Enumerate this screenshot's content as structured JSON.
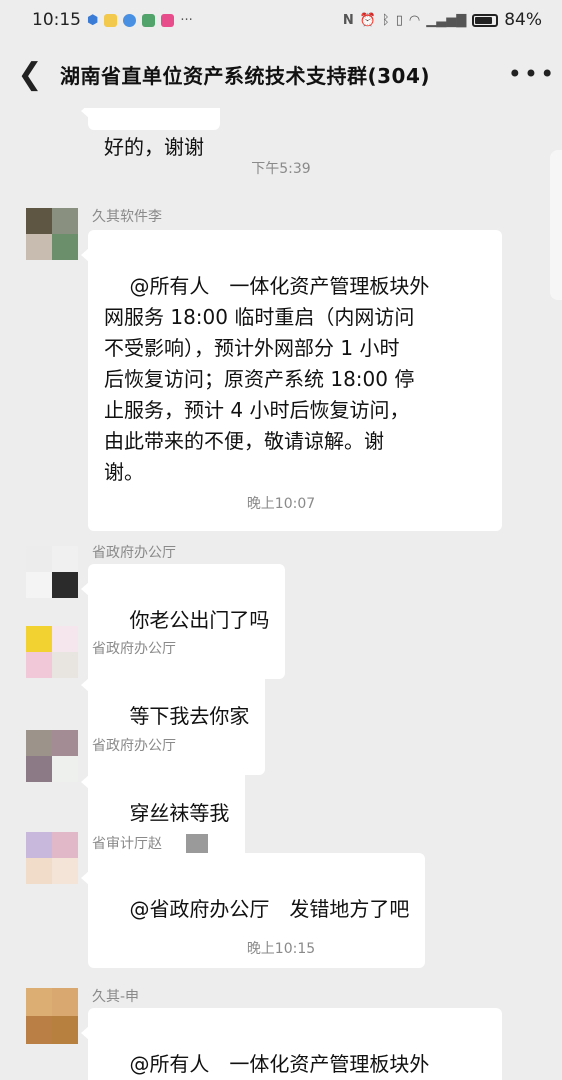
{
  "status": {
    "time": "10:15",
    "battery_text": "84%",
    "battery_level": 0.84
  },
  "header": {
    "title": "湖南省直单位资产系统技术支持群(304)",
    "back_icon": "chevron-left-icon",
    "more_icon": "more-icon"
  },
  "messages": [
    {
      "type": "bubble-partial",
      "text": "好的，谢谢"
    },
    {
      "type": "time",
      "text": "下午5:39"
    },
    {
      "type": "message",
      "sender": "久其软件李",
      "text": "@所有人　一体化资产管理板块外\n网服务 18:00 临时重启（内网访问\n不受影响），预计外网部分 1 小时\n后恢复访问；原资产系统 18:00 停\n止服务，预计 4 小时后恢复访问，\n由此带来的不便，敬请谅解。谢\n谢。"
    },
    {
      "type": "time",
      "text": "晚上10:07"
    },
    {
      "type": "message",
      "sender": "省政府办公厅",
      "text": "你老公出门了吗"
    },
    {
      "type": "message",
      "sender": "省政府办公厅",
      "text": "等下我去你家"
    },
    {
      "type": "message",
      "sender": "省政府办公厅",
      "text": "穿丝袜等我"
    },
    {
      "type": "message",
      "sender": "省审计厅赵",
      "text": "@省政府办公厅　发错地方了吧"
    },
    {
      "type": "time",
      "text": "晚上10:15"
    },
    {
      "type": "message",
      "sender": "久其-申",
      "text": "@所有人　一体化资产管理板块外\n网服务及原资产系统已维护完成，"
    }
  ],
  "colors": {
    "background": "#ededed",
    "bubble": "#ffffff",
    "meta_text": "#8a8a8a"
  }
}
